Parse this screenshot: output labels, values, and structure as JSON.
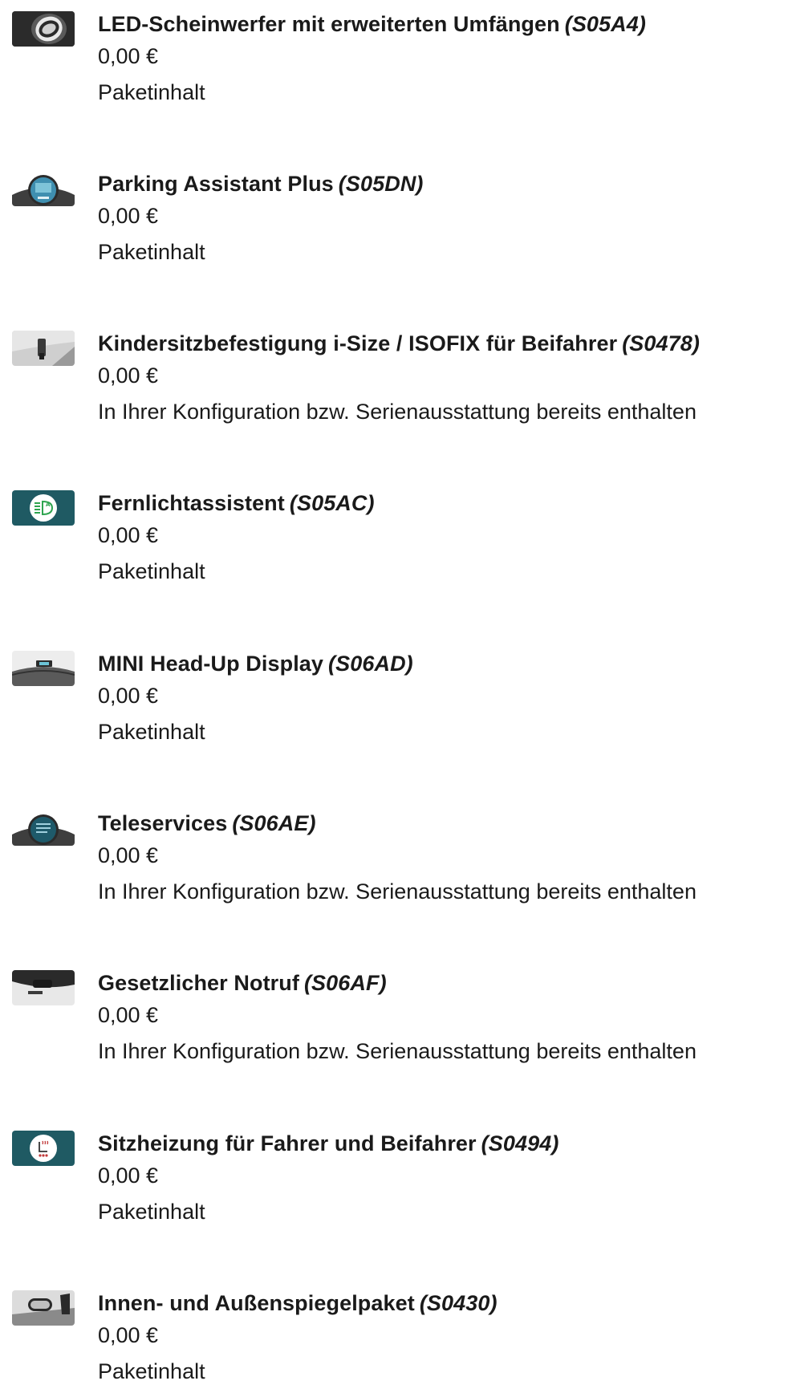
{
  "items": [
    {
      "title": "LED-Scheinwerfer mit erweiterten Umfängen",
      "code": "(S05A4)",
      "price": "0,00 €",
      "note": "Paketinhalt",
      "icon": "led-headlight-icon"
    },
    {
      "title": "Parking Assistant Plus",
      "code": "(S05DN)",
      "price": "0,00 €",
      "note": "Paketinhalt",
      "icon": "parking-display-icon"
    },
    {
      "title": "Kindersitzbefestigung i-Size / ISOFIX für Beifahrer",
      "code": "(S0478)",
      "price": "0,00 €",
      "note": "In Ihrer Konfiguration bzw. Serienausstattung bereits enthalten",
      "icon": "child-seat-mount-icon"
    },
    {
      "title": "Fernlichtassistent",
      "code": "(S05AC)",
      "price": "0,00 €",
      "note": "Paketinhalt",
      "icon": "high-beam-assist-icon"
    },
    {
      "title": "MINI Head-Up Display",
      "code": "(S06AD)",
      "price": "0,00 €",
      "note": "Paketinhalt",
      "icon": "head-up-display-icon"
    },
    {
      "title": "Teleservices",
      "code": "(S06AE)",
      "price": "0,00 €",
      "note": "In Ihrer Konfiguration bzw. Serienausstattung bereits enthalten",
      "icon": "teleservices-display-icon"
    },
    {
      "title": "Gesetzlicher Notruf",
      "code": "(S06AF)",
      "price": "0,00 €",
      "note": "In Ihrer Konfiguration bzw. Serienausstattung bereits enthalten",
      "icon": "emergency-call-icon"
    },
    {
      "title": "Sitzheizung für Fahrer und Beifahrer",
      "code": "(S0494)",
      "price": "0,00 €",
      "note": "Paketinhalt",
      "icon": "seat-heating-icon"
    },
    {
      "title": "Innen- und Außenspiegelpaket",
      "code": "(S0430)",
      "price": "0,00 €",
      "note": "Paketinhalt",
      "icon": "mirror-package-icon"
    }
  ],
  "colors": {
    "teal": "#1f5a63",
    "text": "#1a1a1a"
  }
}
